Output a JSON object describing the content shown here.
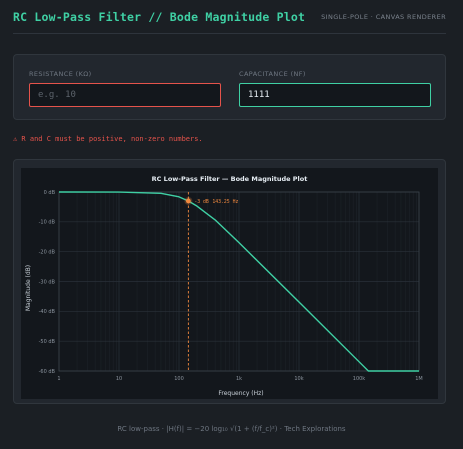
{
  "header": {
    "title": "RC Low-Pass Filter // Bode Magnitude Plot",
    "subtitle": "SINGLE-POLE · CANVAS RENDERER"
  },
  "inputs": {
    "resistance": {
      "label": "RESISTANCE (KΩ)",
      "value": "",
      "placeholder": "e.g. 10",
      "state": "error"
    },
    "capacitance": {
      "label": "CAPACITANCE (NF)",
      "value": "1111",
      "placeholder": "",
      "state": "ok"
    }
  },
  "error_message": "⚠ R and C must be positive, non-zero numbers.",
  "colors": {
    "accent": "#3fd0a4",
    "error": "#e5534b",
    "cutoff_marker": "#f0883e"
  },
  "chart_data": {
    "type": "line",
    "title": "RC Low-Pass Filter — Bode Magnitude Plot",
    "xlabel": "Frequency (Hz)",
    "ylabel": "Magnitude (dB)",
    "xscale": "log",
    "xlim": [
      1,
      1000000
    ],
    "ylim": [
      -60,
      0
    ],
    "x_ticks": [
      {
        "value": 1,
        "label": "1"
      },
      {
        "value": 10,
        "label": "10"
      },
      {
        "value": 100,
        "label": "100"
      },
      {
        "value": 1000,
        "label": "1k"
      },
      {
        "value": 10000,
        "label": "10k"
      },
      {
        "value": 100000,
        "label": "100k"
      },
      {
        "value": 1000000,
        "label": "1M"
      }
    ],
    "y_ticks": [
      {
        "value": 0,
        "label": "0 dB"
      },
      {
        "value": -10,
        "label": "-10 dB"
      },
      {
        "value": -20,
        "label": "-20 dB"
      },
      {
        "value": -30,
        "label": "-30 dB"
      },
      {
        "value": -40,
        "label": "-40 dB"
      },
      {
        "value": -50,
        "label": "-50 dB"
      },
      {
        "value": -60,
        "label": "-60 dB"
      }
    ],
    "grid": true,
    "cutoff_hz": 143.25,
    "cutoff_db": -3,
    "cutoff_label_db": "-3 dB",
    "cutoff_label_hz": "143.25 Hz",
    "floor_db": -60,
    "series": [
      {
        "color": "#3fd0a4",
        "x": [
          1,
          10,
          50,
          100,
          143.25,
          200,
          400,
          1000,
          10000,
          100000,
          143250,
          1000000
        ],
        "y": [
          0,
          -0.02,
          -0.45,
          -1.62,
          -3.01,
          -4.74,
          -9.35,
          -16.97,
          -36.88,
          -56.88,
          -60,
          -60
        ]
      }
    ]
  },
  "footer": "RC low-pass · |H(f)| = −20 log₁₀ √(1 + (f/f_c)²) · Tech Explorations"
}
